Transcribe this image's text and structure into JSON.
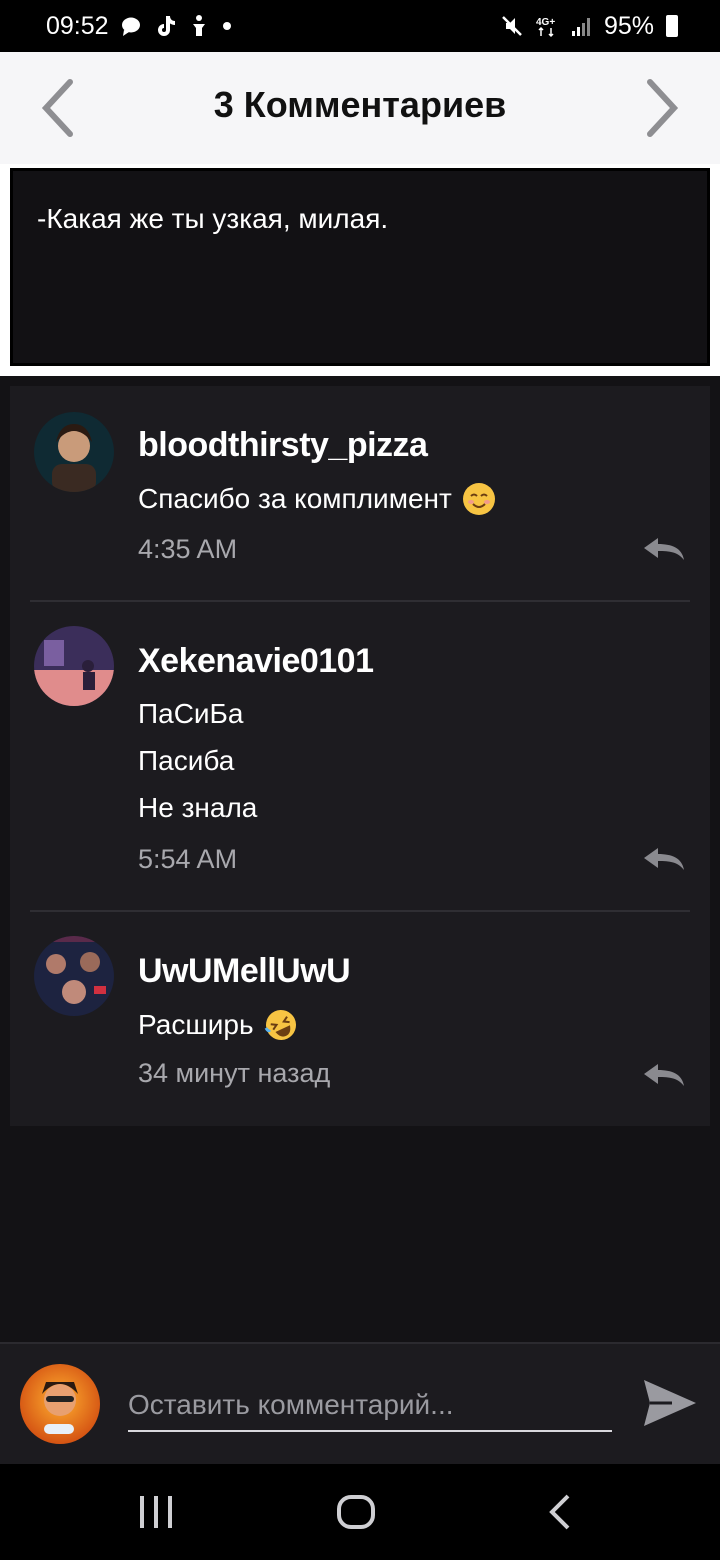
{
  "status_bar": {
    "time": "09:52",
    "battery": "95%",
    "icons": [
      "chat-icon",
      "tiktok-icon",
      "accessibility-icon",
      "dot-icon",
      "mute-icon",
      "lte-icon",
      "signal-icon",
      "battery-icon"
    ]
  },
  "header": {
    "title": "3 Комментариев",
    "prev_icon": "chevron-left-icon",
    "next_icon": "chevron-right-icon"
  },
  "post": {
    "text": "-Какая же ты узкая, милая."
  },
  "comments": [
    {
      "username": "bloodthirsty_pizza",
      "lines": [
        "Спасибо за комплимент"
      ],
      "emoji": "smiling-emoji-icon",
      "time": "4:35 AM"
    },
    {
      "username": "Xekenavie0101",
      "lines": [
        "ПаСиБа",
        "Пасиба",
        "Не знала"
      ],
      "time": "5:54 AM"
    },
    {
      "username": "UwUMellUwU",
      "lines": [
        "Расширь"
      ],
      "emoji": "rofl-emoji-icon",
      "time": "34 минут назад"
    }
  ],
  "compose": {
    "placeholder": "Оставить комментарий...",
    "send_icon": "send-icon"
  },
  "colors": {
    "background": "#131215",
    "card": "#1c1b1f",
    "header_bg": "#f6f6f8",
    "muted_text": "#a8a8ad"
  }
}
